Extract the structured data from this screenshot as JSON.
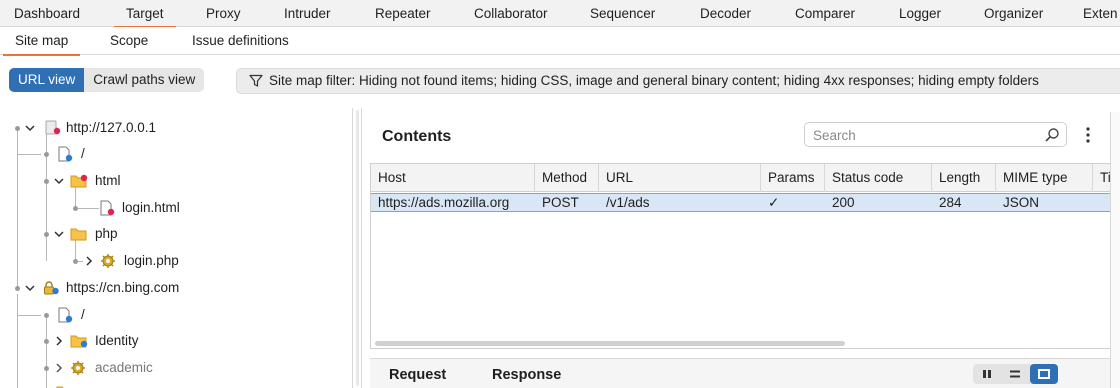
{
  "top_tabs": [
    "Dashboard",
    "Target",
    "Proxy",
    "Intruder",
    "Repeater",
    "Collaborator",
    "Sequencer",
    "Decoder",
    "Comparer",
    "Logger",
    "Organizer",
    "Exten"
  ],
  "top_active": "Target",
  "sub_tabs": [
    "Site map",
    "Scope",
    "Issue definitions"
  ],
  "sub_active": "Site map",
  "view_toggle": {
    "url_view": "URL view",
    "crawl_paths_view": "Crawl paths view",
    "selected": "URL view"
  },
  "filter_text": "Site map filter: Hiding not found items; hiding CSS, image and general binary content; hiding 4xx responses; hiding empty folders",
  "tree": {
    "nodes": [
      {
        "label": "http://127.0.0.1",
        "icon": "host-icon",
        "expanded": true
      },
      {
        "label": "/",
        "icon": "file-blue-icon"
      },
      {
        "label": "html",
        "icon": "folder-red-icon",
        "expanded": true
      },
      {
        "label": "login.html",
        "icon": "file-red-icon"
      },
      {
        "label": "php",
        "icon": "folder-icon",
        "expanded": true
      },
      {
        "label": "login.php",
        "icon": "gear-icon",
        "expanded": false
      },
      {
        "label": "https://cn.bing.com",
        "icon": "secure-host-icon",
        "expanded": true
      },
      {
        "label": "/",
        "icon": "file-blue-icon"
      },
      {
        "label": "Identity",
        "icon": "folder-blue-icon",
        "expanded": false
      },
      {
        "label": "academic",
        "icon": "gear-icon",
        "expanded": false,
        "muted": true
      }
    ]
  },
  "contents": {
    "title": "Contents",
    "search_placeholder": "Search",
    "columns": [
      "Host",
      "Method",
      "URL",
      "Params",
      "Status code",
      "Length",
      "MIME type",
      "Ti"
    ],
    "rows": [
      {
        "host": "https://ads.mozilla.org",
        "method": "POST",
        "url": "/v1/ads",
        "params": "✓",
        "status": "200",
        "length": "284",
        "mime": "JSON",
        "ti": ""
      }
    ]
  },
  "detail_tabs": {
    "request": "Request",
    "response": "Response"
  },
  "colors": {
    "accent": "#e8743b",
    "selection": "#2f6fb3",
    "row_highlight": "#d8e6f5"
  }
}
